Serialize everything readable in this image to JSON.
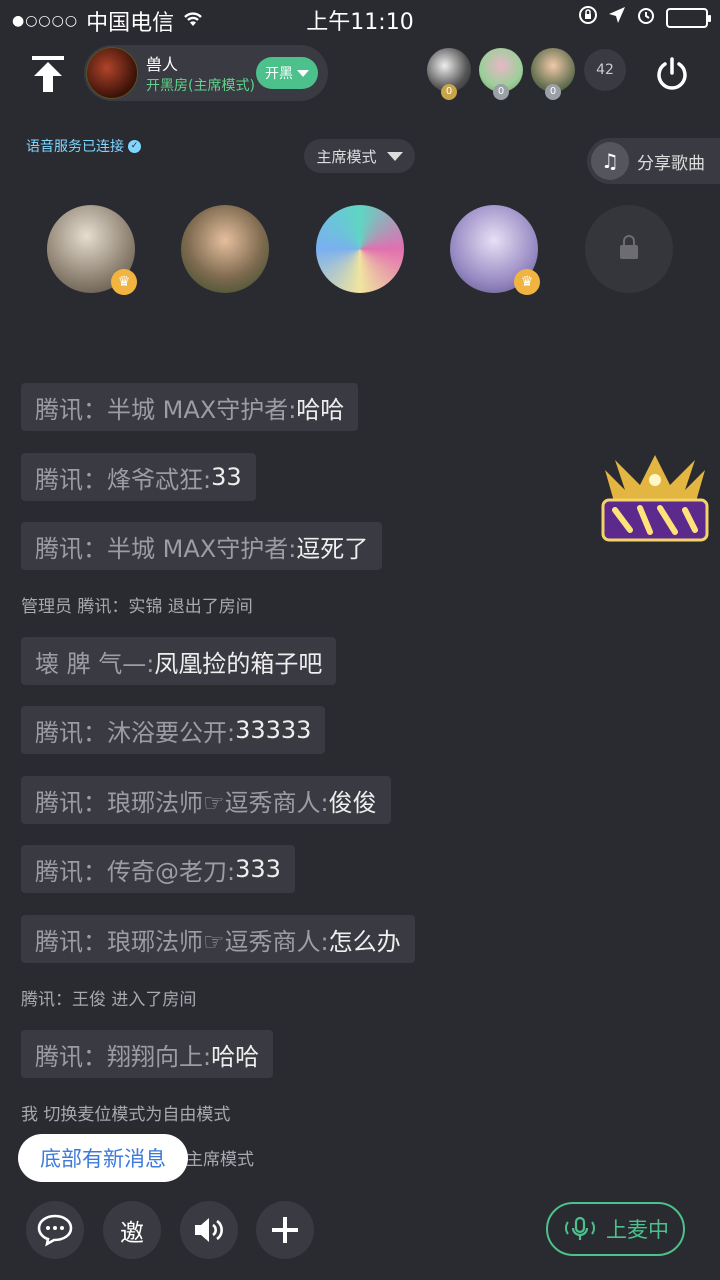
{
  "status_bar": {
    "signal": "●○○○○",
    "carrier": "中国电信",
    "time": "上午11:10"
  },
  "room": {
    "name": "兽人",
    "subtitle": "开黑房(主席模式)",
    "open_label": "开黑",
    "listener_counts": [
      "0",
      "0",
      "0"
    ],
    "online_count": "42"
  },
  "voice_status": "语音服务已连接",
  "mode_selector": "主席模式",
  "share_song": "分享歌曲",
  "chat": [
    {
      "type": "bubble",
      "sender": "腾讯：半城 MAX守护者: ",
      "text": "哈哈"
    },
    {
      "type": "bubble",
      "sender": "腾讯：烽爷忒狂: ",
      "text": "33"
    },
    {
      "type": "bubble",
      "sender": "腾讯：半城 MAX守护者: ",
      "text": "逗死了"
    },
    {
      "type": "system",
      "text": "管理员 腾讯：实锦 退出了房间"
    },
    {
      "type": "bubble",
      "sender": "壊 脾 气—: ",
      "text": "凤凰捡的箱子吧"
    },
    {
      "type": "bubble",
      "sender": "腾讯：沐浴要公开: ",
      "text": "33333"
    },
    {
      "type": "bubble",
      "sender": "腾讯：琅琊法师☞逗秀商人: ",
      "text": "俊俊"
    },
    {
      "type": "bubble",
      "sender": "腾讯：传奇@老刀: ",
      "text": "333"
    },
    {
      "type": "bubble",
      "sender": "腾讯：琅琊法师☞逗秀商人: ",
      "text": "怎么办"
    },
    {
      "type": "system",
      "text": "腾讯：王俊 进入了房间"
    },
    {
      "type": "bubble",
      "sender": "腾讯：翔翔向上: ",
      "text": "哈哈"
    },
    {
      "type": "system",
      "text": "我 切换麦位模式为自由模式"
    },
    {
      "type": "system",
      "text": "主席模式"
    }
  ],
  "new_message_toast": "底部有新消息",
  "toolbar": {
    "invite_label": "邀",
    "mic_label": "上麦中"
  },
  "colors": {
    "background": "#2a2a31",
    "accent_green": "#4cc18b",
    "link_blue": "#3d7bd9"
  }
}
